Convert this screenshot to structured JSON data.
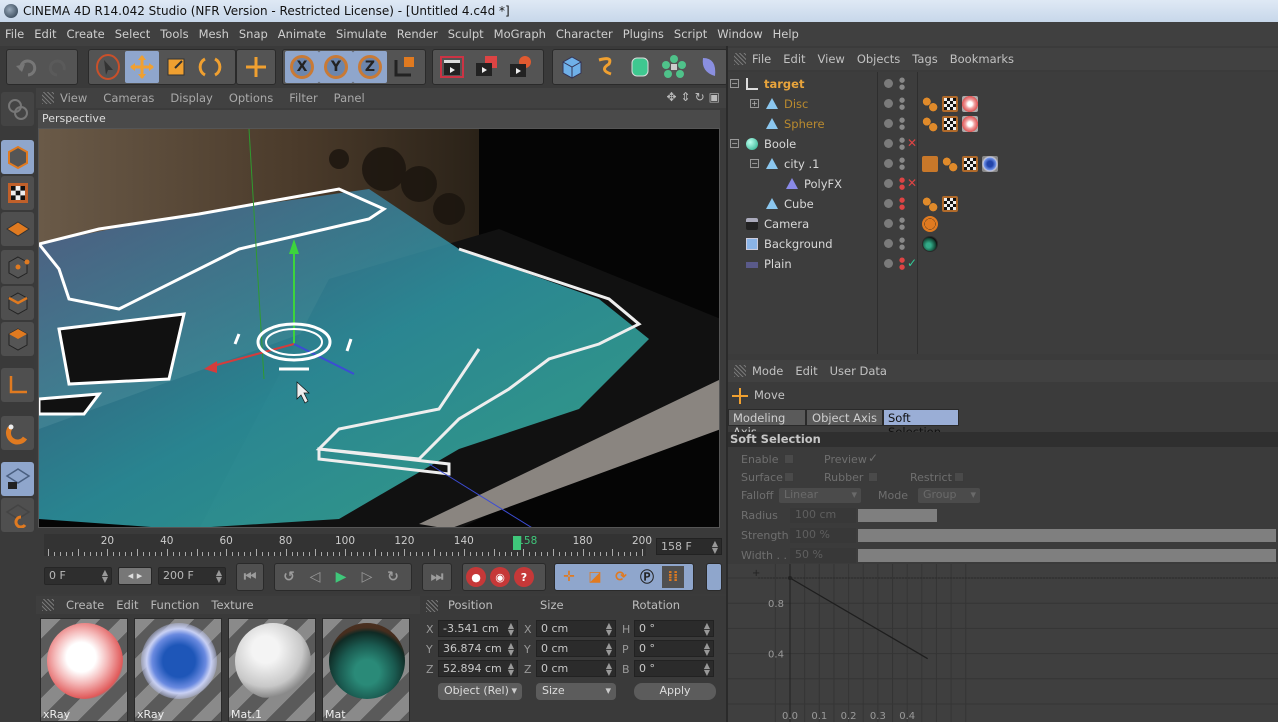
{
  "window": {
    "title": "CINEMA 4D R14.042 Studio (NFR Version - Restricted License) - [Untitled 4.c4d *]"
  },
  "menubar": [
    "File",
    "Edit",
    "Create",
    "Select",
    "Tools",
    "Mesh",
    "Snap",
    "Animate",
    "Simulate",
    "Render",
    "Sculpt",
    "MoGraph",
    "Character",
    "Plugins",
    "Script",
    "Window",
    "Help"
  ],
  "toolbar": {
    "undo": "undo-icon",
    "redo": "redo-icon",
    "tools": [
      "live-selection",
      "move",
      "scale",
      "rotate",
      "recent-tool"
    ],
    "axes": [
      "X",
      "Y",
      "Z"
    ],
    "coord_system": "world-coordinate-icon",
    "render": [
      "render-view",
      "render-to-picture-viewer",
      "render-settings"
    ],
    "objects": [
      "cube",
      "spline-pen",
      "nurbs",
      "array",
      "deformer"
    ]
  },
  "viewport": {
    "menu": [
      "View",
      "Cameras",
      "Display",
      "Options",
      "Filter",
      "Panel"
    ],
    "label": "Perspective"
  },
  "left_tools": [
    "make-editable",
    "model-mode",
    "texture-mode",
    "workplane-mode",
    "point-mode",
    "edge-mode",
    "polygon-mode",
    "axis-mode",
    "snap-tweak",
    "locked-workplane",
    "planar-workplane"
  ],
  "timeline": {
    "ticks": [
      "20",
      "40",
      "60",
      "80",
      "100",
      "120",
      "140",
      "158",
      "180",
      "200"
    ],
    "start": 0,
    "end": 200,
    "current": 158,
    "current_display": "158 F"
  },
  "transport": {
    "start_field": "0 F",
    "end_field": "200 F",
    "buttons": [
      "go-to-start",
      "go-to-previous-key",
      "go-to-previous-frame",
      "play-forwards",
      "go-to-next-frame",
      "go-to-next-key",
      "go-to-end"
    ],
    "record": [
      "record-active-objects",
      "autokeying",
      "keyframe-selection"
    ],
    "key_buttons": [
      "record-position",
      "record-scale",
      "record-rotation",
      "record-parameter",
      "record-point-level"
    ]
  },
  "materials": {
    "menu": [
      "Create",
      "Edit",
      "Function",
      "Texture"
    ],
    "items": [
      {
        "name": "xRay",
        "preview": "red-xray"
      },
      {
        "name": "xRay",
        "preview": "blue-xray"
      },
      {
        "name": "Mat.1",
        "preview": "white"
      },
      {
        "name": "Mat",
        "preview": "city-texture"
      }
    ]
  },
  "coordinates": {
    "headers": [
      "Position",
      "Size",
      "Rotation"
    ],
    "position": {
      "X": "-3.541 cm",
      "Y": "36.874 cm",
      "Z": "52.894 cm"
    },
    "size": {
      "X": "0 cm",
      "Y": "0 cm",
      "Z": "0 cm"
    },
    "rotation": {
      "H": "0 °",
      "P": "0 °",
      "B": "0 °"
    },
    "mode_dropdown": "Object (Rel)",
    "size_dropdown": "Size",
    "apply_label": "Apply"
  },
  "object_manager": {
    "menu": [
      "File",
      "Edit",
      "View",
      "Objects",
      "Tags",
      "Bookmarks"
    ],
    "objects": [
      {
        "name": "target",
        "color": "#e8a43c",
        "depth": 0,
        "icon": "null-object-icon",
        "expanded": true,
        "tags": []
      },
      {
        "name": "Disc",
        "color": "#b98a2f",
        "depth": 1,
        "icon": "disc-icon",
        "expanded": false,
        "tags": [
          "compositing",
          "texture",
          "xray-material"
        ]
      },
      {
        "name": "Sphere",
        "color": "#b98a2f",
        "depth": 1,
        "icon": "sphere-icon",
        "tags": [
          "compositing",
          "texture",
          "xray-material"
        ]
      },
      {
        "name": "Boole",
        "color": "#d8d8d8",
        "depth": 0,
        "icon": "boole-icon",
        "expanded": true,
        "disabled": true,
        "tags": []
      },
      {
        "name": "city .1",
        "color": "#d8d8d8",
        "depth": 1,
        "icon": "polygon-icon",
        "expanded": true,
        "tags": [
          "display",
          "compositing",
          "texture",
          "blue-xray-material"
        ]
      },
      {
        "name": "PolyFX",
        "color": "#d8d8d8",
        "depth": 2,
        "icon": "polyfx-icon",
        "disabled": true,
        "tags": []
      },
      {
        "name": "Cube",
        "color": "#d8d8d8",
        "depth": 1,
        "icon": "cube-icon",
        "tags": [
          "compositing",
          "texture"
        ]
      },
      {
        "name": "Camera",
        "color": "#d8d8d8",
        "depth": 0,
        "icon": "camera-icon",
        "tags": [
          "protection"
        ]
      },
      {
        "name": "Background",
        "color": "#d8d8d8",
        "depth": 0,
        "icon": "background-icon",
        "tags": [
          "city-material"
        ]
      },
      {
        "name": "Plain",
        "color": "#d8d8d8",
        "depth": 0,
        "icon": "plain-deformer-icon",
        "enabled_check": true,
        "tags": []
      }
    ]
  },
  "attributes": {
    "menu": [
      "Mode",
      "Edit",
      "User Data"
    ],
    "tool_name": "Move",
    "tabs": [
      {
        "label": "Modeling Axis",
        "active": false
      },
      {
        "label": "Object Axis",
        "active": false
      },
      {
        "label": "Soft Selection",
        "active": true
      }
    ],
    "section": "Soft Selection",
    "enable_label": "Enable",
    "enable": false,
    "preview_label": "Preview",
    "preview": true,
    "surface_label": "Surface",
    "surface": false,
    "rubber_label": "Rubber",
    "rubber": false,
    "restrict_label": "Restrict",
    "restrict": false,
    "falloff_label": "Falloff",
    "falloff": "Linear",
    "mode_label": "Mode",
    "mode": "Group",
    "radius_label": "Radius",
    "radius": "100 cm",
    "radius_fraction": 0.19,
    "strength_label": "Strength",
    "strength": "100 %",
    "strength_fraction": 1.0,
    "width_label": "Width . .",
    "width": "50 %",
    "width_fraction": 1.0
  },
  "falloff_graph": {
    "y_ticks": [
      "0.8",
      "0.4"
    ],
    "x_ticks": [
      "0.0",
      "0.1",
      "0.2",
      "0.3",
      "0.4"
    ],
    "curve": [
      [
        0,
        1.0
      ],
      [
        0.47,
        0.36
      ]
    ]
  }
}
